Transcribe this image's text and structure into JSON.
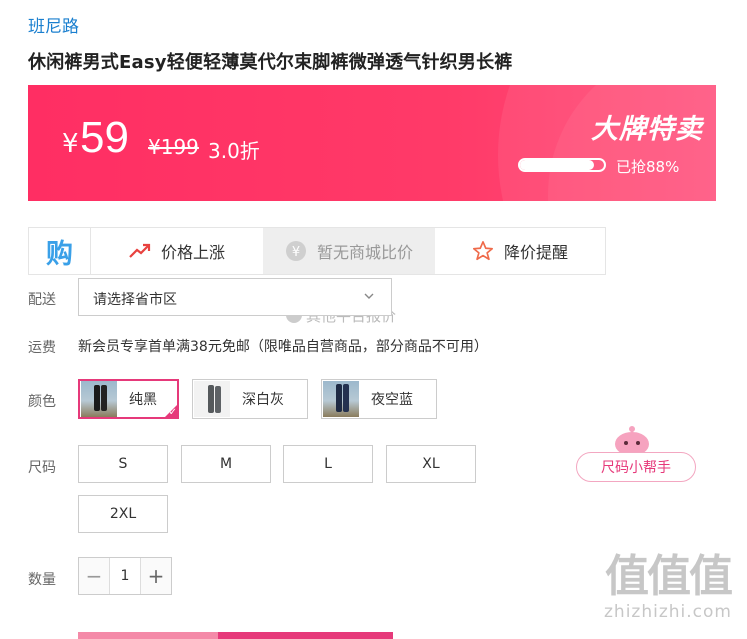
{
  "brand": "班尼路",
  "title": "休闲裤男式Easy轻便轻薄莫代尔束脚裤微弹透气针织男长裤",
  "promo": {
    "currency": "¥",
    "price": "59",
    "original_price": "¥199",
    "discount": "3.0折",
    "badge": "大牌特卖",
    "sold_text": "已抢88%",
    "sold_progress": 0.88,
    "color_start": "#ff2e63",
    "color_end": "#ff4e7a"
  },
  "toolbar": {
    "logo": "购",
    "items": [
      {
        "label": "价格上涨",
        "icon": "trend-up-icon"
      },
      {
        "label": "暂无商城比价",
        "icon": "yen-circle-icon"
      },
      {
        "label": "降价提醒",
        "icon": "star-icon"
      }
    ]
  },
  "labels": {
    "delivery": "配送",
    "shipping": "运费",
    "color": "颜色",
    "size": "尺码",
    "quantity": "数量"
  },
  "delivery": {
    "value": "请选择省市区",
    "overlay_text": "其他平台报价"
  },
  "shipping_text": "新会员专享首单满38元免邮（限唯品自营商品，部分商品不可用）",
  "colors": [
    {
      "label": "纯黑",
      "selected": true
    },
    {
      "label": "深白灰",
      "selected": false
    },
    {
      "label": "夜空蓝",
      "selected": false
    }
  ],
  "sizes": [
    "S",
    "M",
    "L",
    "XL",
    "2XL"
  ],
  "size_helper": "尺码小帮手",
  "quantity": "1",
  "stepper": {
    "minus": "−",
    "plus": "+"
  },
  "watermark": {
    "big": "值值值",
    "small": "zhizhizhi.com"
  },
  "accent": "#e6397a"
}
